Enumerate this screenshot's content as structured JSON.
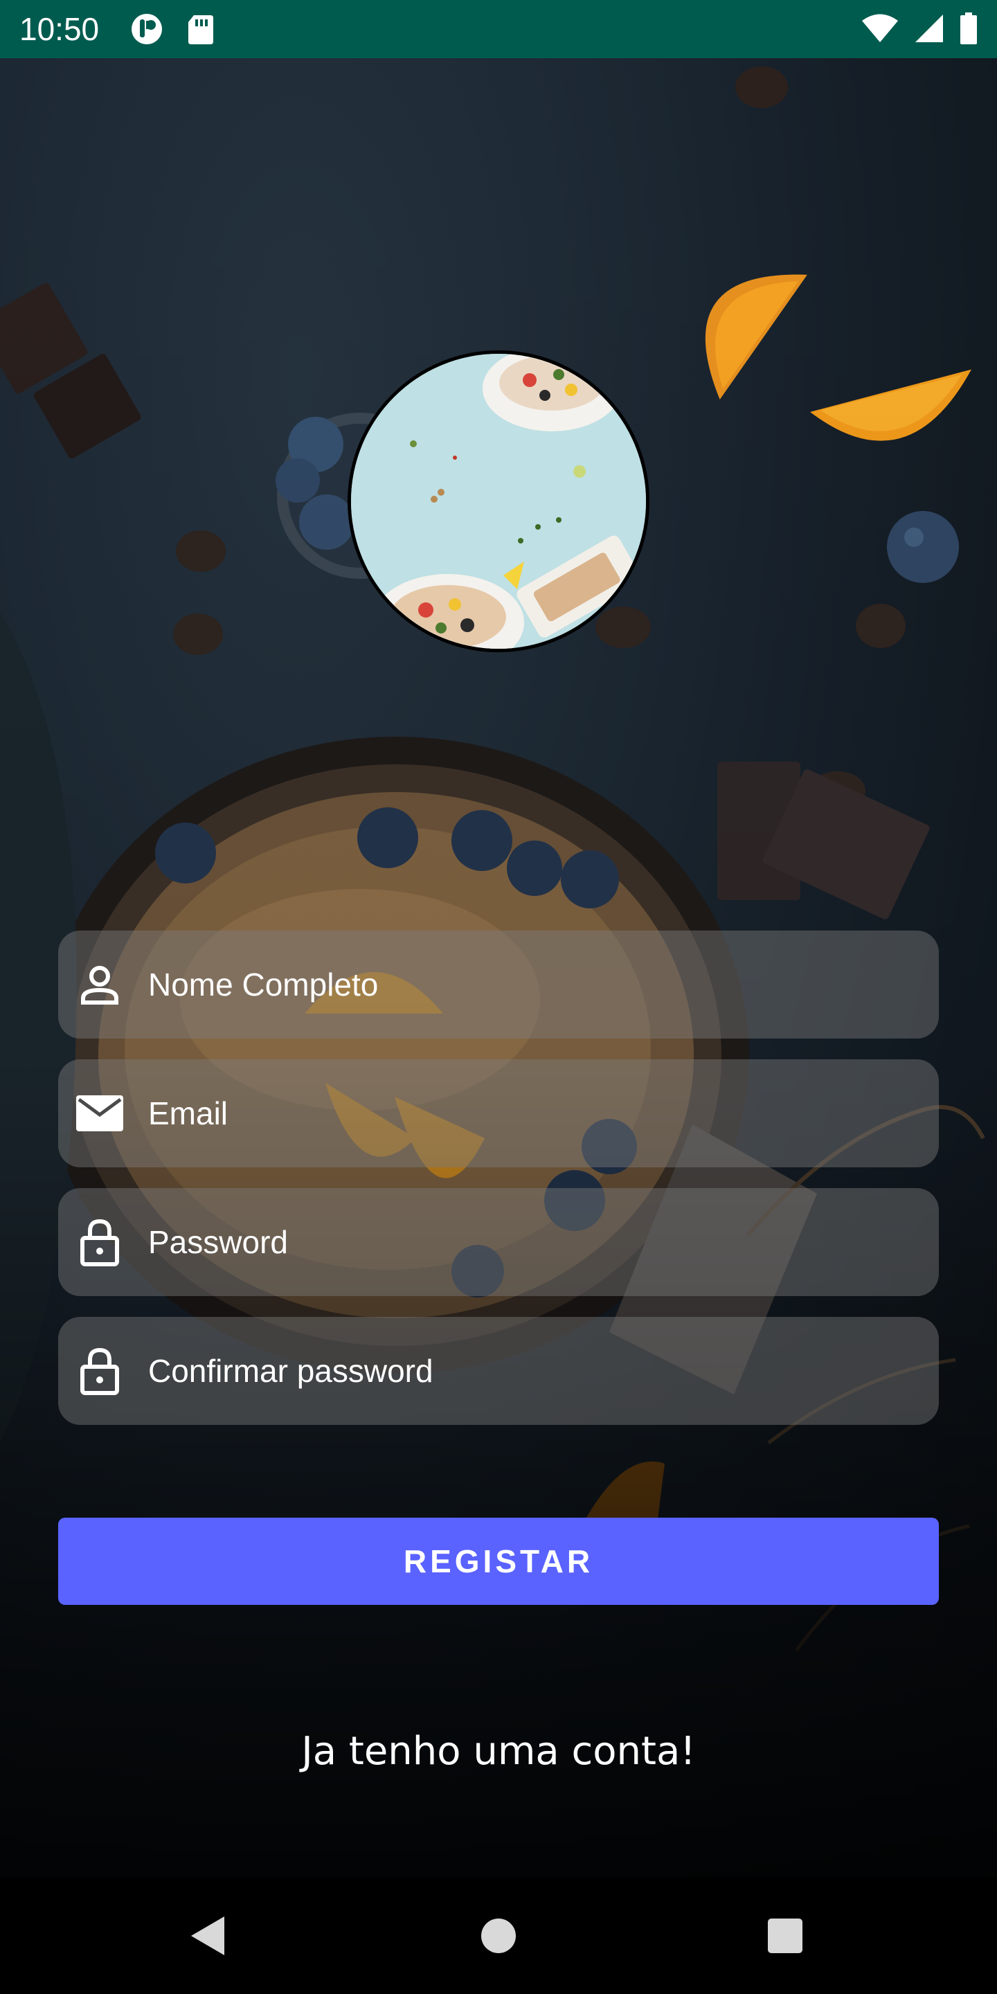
{
  "status_bar": {
    "time": "10:50",
    "icons": [
      "notification-app-icon",
      "sd-card-icon",
      "wifi-icon",
      "cell-signal-icon",
      "battery-icon"
    ],
    "background_color": "#005b4f"
  },
  "logo": {
    "description_icon": "food-logo-icon"
  },
  "form": {
    "full_name": {
      "placeholder": "Nome Completo",
      "icon": "person-icon"
    },
    "email": {
      "placeholder": "Email",
      "icon": "mail-icon"
    },
    "password": {
      "placeholder": "Password",
      "icon": "lock-icon"
    },
    "confirm_password": {
      "placeholder": "Confirmar password",
      "icon": "lock-icon"
    }
  },
  "register_button": {
    "label": "REGISTAR",
    "color": "#5a63ff"
  },
  "login_link": {
    "label": "Ja tenho uma conta!"
  },
  "nav_bar": {
    "icons": [
      "back-icon",
      "home-icon",
      "recents-icon"
    ]
  }
}
